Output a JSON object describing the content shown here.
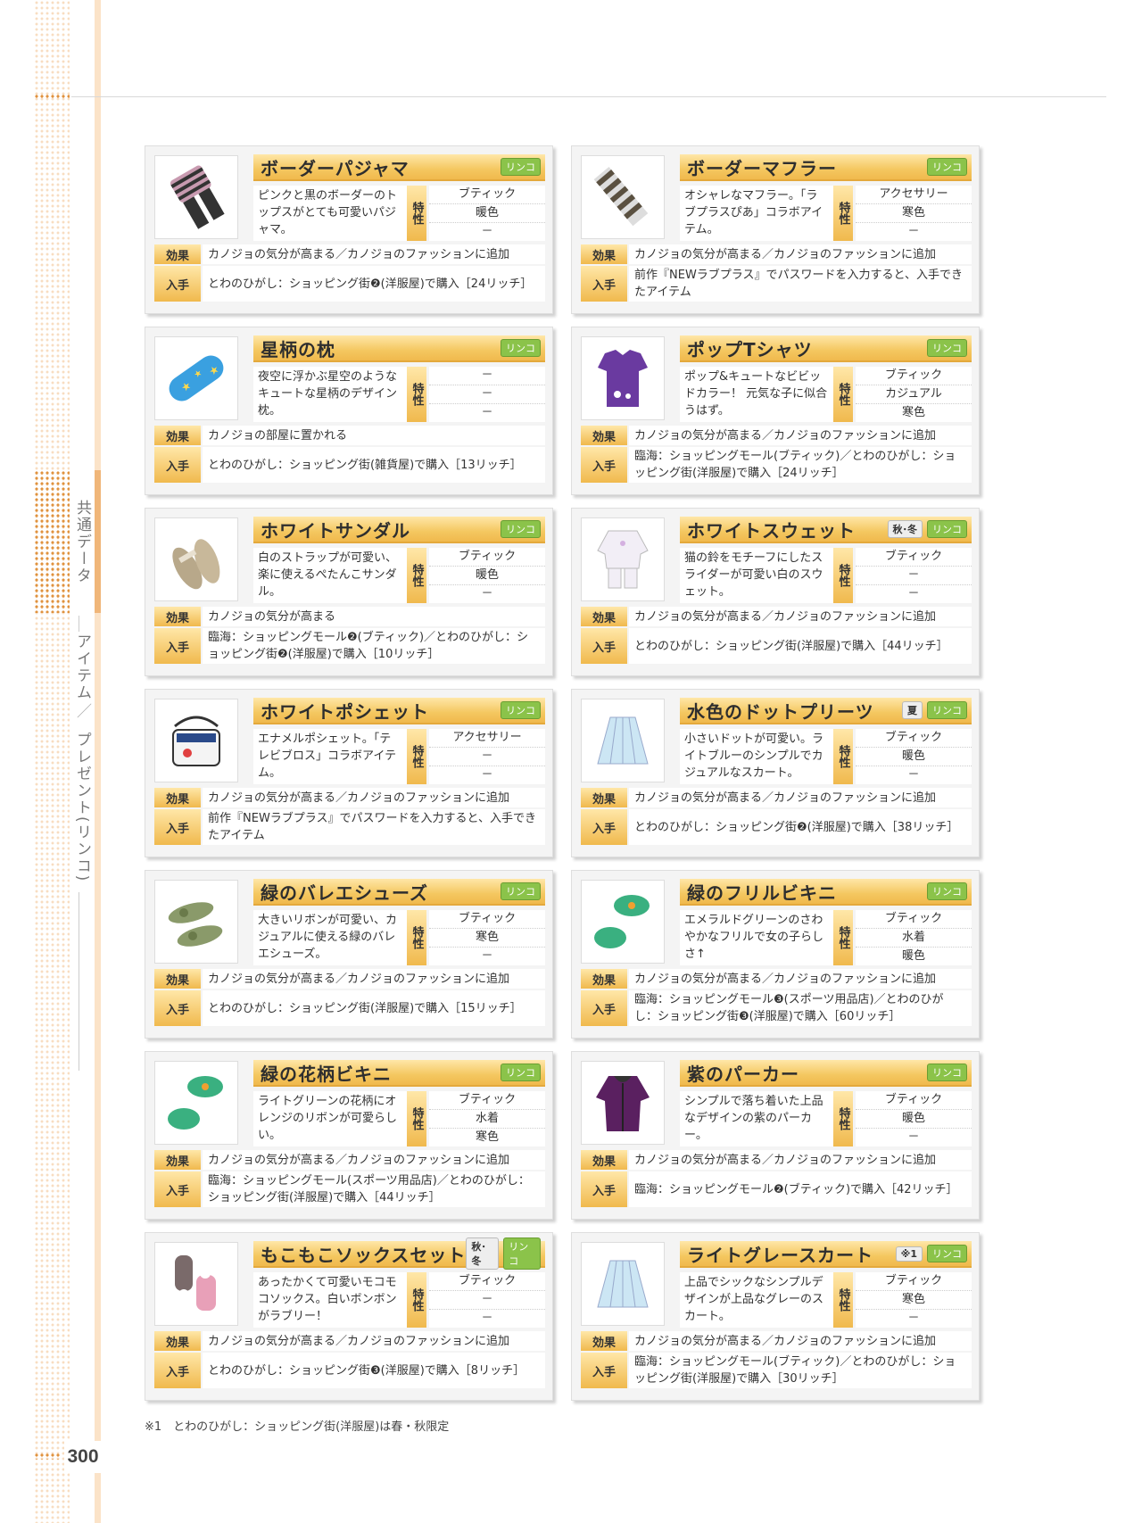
{
  "sidebar": {
    "section": "共通データ",
    "category": "アイテム",
    "separator": "／",
    "subcategory": "プレゼント(リンコ)"
  },
  "labels": {
    "trait": "特性",
    "effect": "効果",
    "obtain": "入手"
  },
  "items": [
    {
      "name": "ボーダーパジャマ",
      "badge": "リンコ",
      "season": "",
      "icon": "pajama-icon",
      "desc": "ピンクと黒のボーダーのトップスがとても可愛いパジャマ。",
      "traits": [
        "ブティック",
        "暖色",
        "－"
      ],
      "effect": "カノジョの気分が高まる／カノジョのファッションに追加",
      "obtain": "とわのひがし：ショッピング街❷(洋服屋)で購入［24リッチ］"
    },
    {
      "name": "ボーダーマフラー",
      "badge": "リンコ",
      "season": "",
      "icon": "scarf-icon",
      "desc": "オシャレなマフラー。「ラブプラスぴあ」コラボアイテム。",
      "traits": [
        "アクセサリー",
        "寒色",
        "－"
      ],
      "effect": "カノジョの気分が高まる／カノジョのファッションに追加",
      "obtain": "前作『NEWラブプラス』でパスワードを入力すると、入手できたアイテム"
    },
    {
      "name": "星柄の枕",
      "badge": "リンコ",
      "season": "",
      "icon": "pillow-icon",
      "desc": "夜空に浮かぶ星空のようなキュートな星柄のデザイン枕。",
      "traits": [
        "－",
        "－",
        "－"
      ],
      "effect": "カノジョの部屋に置かれる",
      "obtain": "とわのひがし：ショッピング街(雑貨屋)で購入［13リッチ］"
    },
    {
      "name": "ポップTシャツ",
      "badge": "リンコ",
      "season": "",
      "icon": "tshirt-icon",
      "desc": "ポップ&キュートなビビッドカラー！ 元気な子に似合うはず。",
      "traits": [
        "ブティック",
        "カジュアル",
        "寒色"
      ],
      "effect": "カノジョの気分が高まる／カノジョのファッションに追加",
      "obtain": "臨海：ショッピングモール(ブティック)／とわのひがし：ショッピング街(洋服屋)で購入［24リッチ］"
    },
    {
      "name": "ホワイトサンダル",
      "badge": "リンコ",
      "season": "",
      "icon": "sandal-icon",
      "desc": "白のストラップが可愛い、楽に使えるぺたんこサンダル。",
      "traits": [
        "ブティック",
        "暖色",
        "－"
      ],
      "effect": "カノジョの気分が高まる",
      "obtain": "臨海：ショッピングモール❷(ブティック)／とわのひがし：ショッピング街❷(洋服屋)で購入［10リッチ］"
    },
    {
      "name": "ホワイトスウェット",
      "badge": "リンコ",
      "season": "秋･冬",
      "icon": "sweat-icon",
      "desc": "猫の鈴をモチーフにしたスライダーが可愛い白のスウェット。",
      "traits": [
        "ブティック",
        "－",
        "－"
      ],
      "effect": "カノジョの気分が高まる／カノジョのファッションに追加",
      "obtain": "とわのひがし：ショッピング街(洋服屋)で購入［44リッチ］"
    },
    {
      "name": "ホワイトポシェット",
      "badge": "リンコ",
      "season": "",
      "icon": "pochette-icon",
      "desc": "エナメルポシェット。「テレビブロス」コラボアイテム。",
      "traits": [
        "アクセサリー",
        "－",
        "－"
      ],
      "effect": "カノジョの気分が高まる／カノジョのファッションに追加",
      "obtain": "前作『NEWラブプラス』でパスワードを入力すると、入手できたアイテム"
    },
    {
      "name": "水色のドットプリーツ",
      "badge": "リンコ",
      "season": "夏",
      "icon": "skirt-icon",
      "desc": "小さいドットが可愛い。ライトブルーのシンプルでカジュアルなスカート。",
      "traits": [
        "ブティック",
        "暖色",
        "－"
      ],
      "effect": "カノジョの気分が高まる／カノジョのファッションに追加",
      "obtain": "とわのひがし：ショッピング街❷(洋服屋)で購入［38リッチ］"
    },
    {
      "name": "緑のバレエシューズ",
      "badge": "リンコ",
      "season": "",
      "icon": "shoes-icon",
      "desc": "大きいリボンが可愛い、カジュアルに使える緑のバレエシューズ。",
      "traits": [
        "ブティック",
        "寒色",
        "－"
      ],
      "effect": "カノジョの気分が高まる／カノジョのファッションに追加",
      "obtain": "とわのひがし：ショッピング街(洋服屋)で購入［15リッチ］"
    },
    {
      "name": "緑のフリルビキニ",
      "badge": "リンコ",
      "season": "",
      "icon": "bikini-icon",
      "desc": "エメラルドグリーンのさわやかなフリルで女の子らしさ↑",
      "traits": [
        "ブティック",
        "水着",
        "暖色"
      ],
      "effect": "カノジョの気分が高まる／カノジョのファッションに追加",
      "obtain": "臨海：ショッピングモール❸(スポーツ用品店)／とわのひがし：ショッピング街❸(洋服屋)で購入［60リッチ］"
    },
    {
      "name": "緑の花柄ビキニ",
      "badge": "リンコ",
      "season": "",
      "icon": "bikini-icon",
      "desc": "ライトグリーンの花柄にオレンジのリボンが可愛らしい。",
      "traits": [
        "ブティック",
        "水着",
        "寒色"
      ],
      "effect": "カノジョの気分が高まる／カノジョのファッションに追加",
      "obtain": "臨海：ショッピングモール(スポーツ用品店)／とわのひがし：ショッピング街(洋服屋)で購入［44リッチ］"
    },
    {
      "name": "紫のパーカー",
      "badge": "リンコ",
      "season": "",
      "icon": "hoodie-icon",
      "desc": "シンプルで落ち着いた上品なデザインの紫のパーカー。",
      "traits": [
        "ブティック",
        "暖色",
        "－"
      ],
      "effect": "カノジョの気分が高まる／カノジョのファッションに追加",
      "obtain": "臨海：ショッピングモール❷(ブティック)で購入［42リッチ］"
    },
    {
      "name": "もこもこソックスセット",
      "badge": "リンコ",
      "season": "秋･冬",
      "icon": "socks-icon",
      "desc": "あったかくて可愛いモコモコソックス。白いボンボンがラブリー！",
      "traits": [
        "ブティック",
        "－",
        "－"
      ],
      "effect": "カノジョの気分が高まる／カノジョのファッションに追加",
      "obtain": "とわのひがし：ショッピング街❸(洋服屋)で購入［8リッチ］"
    },
    {
      "name": "ライトグレースカート",
      "badge": "リンコ",
      "season": "※1",
      "icon": "skirt-icon",
      "desc": "上品でシックなシンプルデザインが上品なグレーのスカート。",
      "traits": [
        "ブティック",
        "寒色",
        "－"
      ],
      "effect": "カノジョの気分が高まる／カノジョのファッションに追加",
      "obtain": "臨海：ショッピングモール(ブティック)／とわのひがし：ショッピング街(洋服屋)で購入［30リッチ］"
    }
  ],
  "footnote": "※1　とわのひがし：ショッピング街(洋服屋)は春・秋限定",
  "page_number": "300",
  "colors": {
    "accent": "#f0b94d",
    "badge_green": "#8bc34a",
    "margin_orange": "#e0923e"
  }
}
